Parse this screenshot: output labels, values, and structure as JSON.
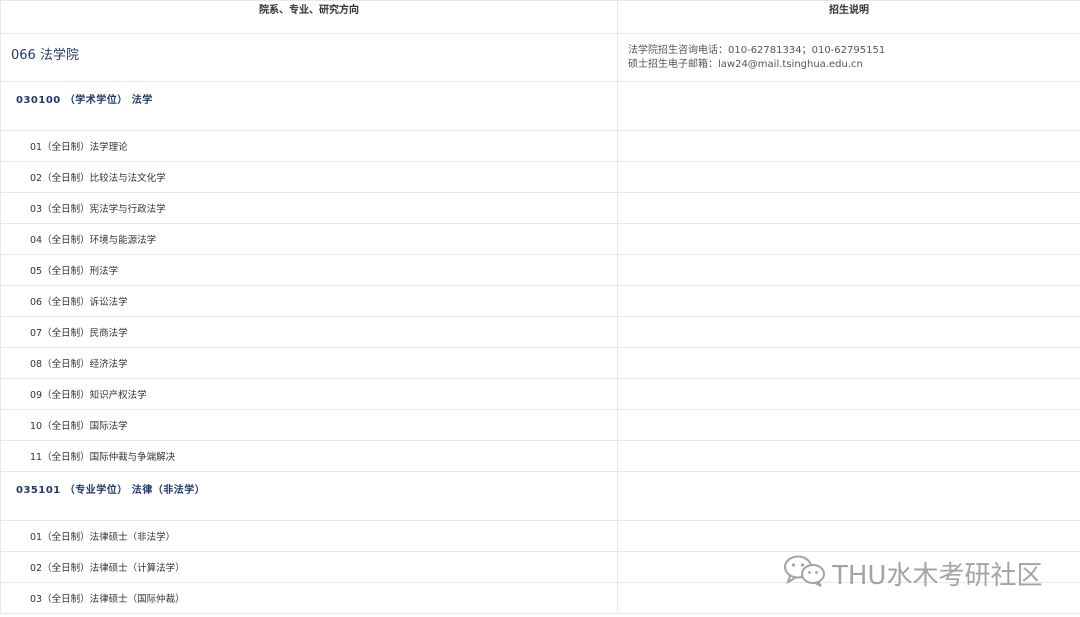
{
  "header": {
    "col1": "院系、专业、研究方向",
    "col2": "招生说明"
  },
  "department": {
    "code": "066",
    "name": "法学院",
    "info_line1": "法学院招生咨询电话：010-62781334；010-62795151",
    "info_line2": "硕士招生电子邮箱：law24@mail.tsinghua.edu.cn"
  },
  "majors": [
    {
      "title": "030100 （学术学位） 法学",
      "directions": [
        "01（全日制）法学理论",
        "02（全日制）比较法与法文化学",
        "03（全日制）宪法学与行政法学",
        "04（全日制）环境与能源法学",
        "05（全日制）刑法学",
        "06（全日制）诉讼法学",
        "07（全日制）民商法学",
        "08（全日制）经济法学",
        "09（全日制）知识产权法学",
        "10（全日制）国际法学",
        "11（全日制）国际仲裁与争端解决"
      ]
    },
    {
      "title": "035101 （专业学位） 法律（非法学）",
      "directions": [
        "01（全日制）法律硕士（非法学）",
        "02（全日制）法律硕士（计算法学）",
        "03（全日制）法律硕士（国际仲裁）"
      ]
    }
  ],
  "watermark": {
    "text": "THU水木考研社区",
    "icon": "wechat-icon"
  }
}
